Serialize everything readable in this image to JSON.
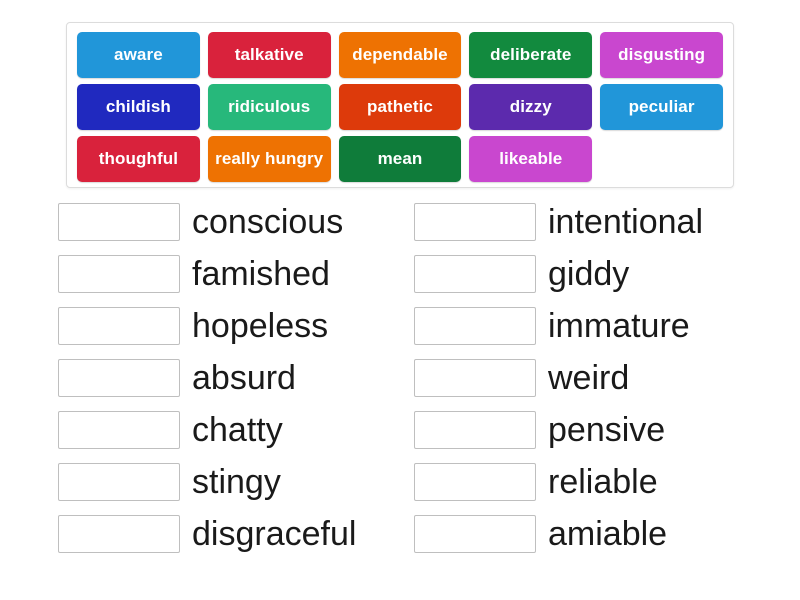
{
  "activity": {
    "type": "match-up-drag-and-drop",
    "tile_bank": {
      "rows": [
        [
          {
            "label": "aware",
            "color": "#2196d9"
          },
          {
            "label": "talkative",
            "color": "#d9223c"
          },
          {
            "label": "dependable",
            "color": "#ee7202"
          },
          {
            "label": "deliberate",
            "color": "#128a3e"
          },
          {
            "label": "disgusting",
            "color": "#c947cf"
          }
        ],
        [
          {
            "label": "childish",
            "color": "#2029bf"
          },
          {
            "label": "ridiculous",
            "color": "#27b87b"
          },
          {
            "label": "pathetic",
            "color": "#dd3a0b"
          },
          {
            "label": "dizzy",
            "color": "#5c2aad"
          },
          {
            "label": "peculiar",
            "color": "#2196d9"
          }
        ],
        [
          {
            "label": "thoughful",
            "color": "#d9223c"
          },
          {
            "label": "really hungry",
            "color": "#ee7202"
          },
          {
            "label": "mean",
            "color": "#0f7c3a"
          },
          {
            "label": "likeable",
            "color": "#c947cf"
          },
          {
            "label": "",
            "color": "transparent",
            "empty": true
          }
        ]
      ]
    },
    "answers": {
      "left_column": [
        {
          "word": "conscious",
          "slot_value": ""
        },
        {
          "word": "famished",
          "slot_value": ""
        },
        {
          "word": "hopeless",
          "slot_value": ""
        },
        {
          "word": "absurd",
          "slot_value": ""
        },
        {
          "word": "chatty",
          "slot_value": ""
        },
        {
          "word": "stingy",
          "slot_value": ""
        },
        {
          "word": "disgraceful",
          "slot_value": ""
        }
      ],
      "right_column": [
        {
          "word": "intentional",
          "slot_value": ""
        },
        {
          "word": "giddy",
          "slot_value": ""
        },
        {
          "word": "immature",
          "slot_value": ""
        },
        {
          "word": "weird",
          "slot_value": ""
        },
        {
          "word": "pensive",
          "slot_value": ""
        },
        {
          "word": "reliable",
          "slot_value": ""
        },
        {
          "word": "amiable",
          "slot_value": ""
        }
      ]
    }
  }
}
